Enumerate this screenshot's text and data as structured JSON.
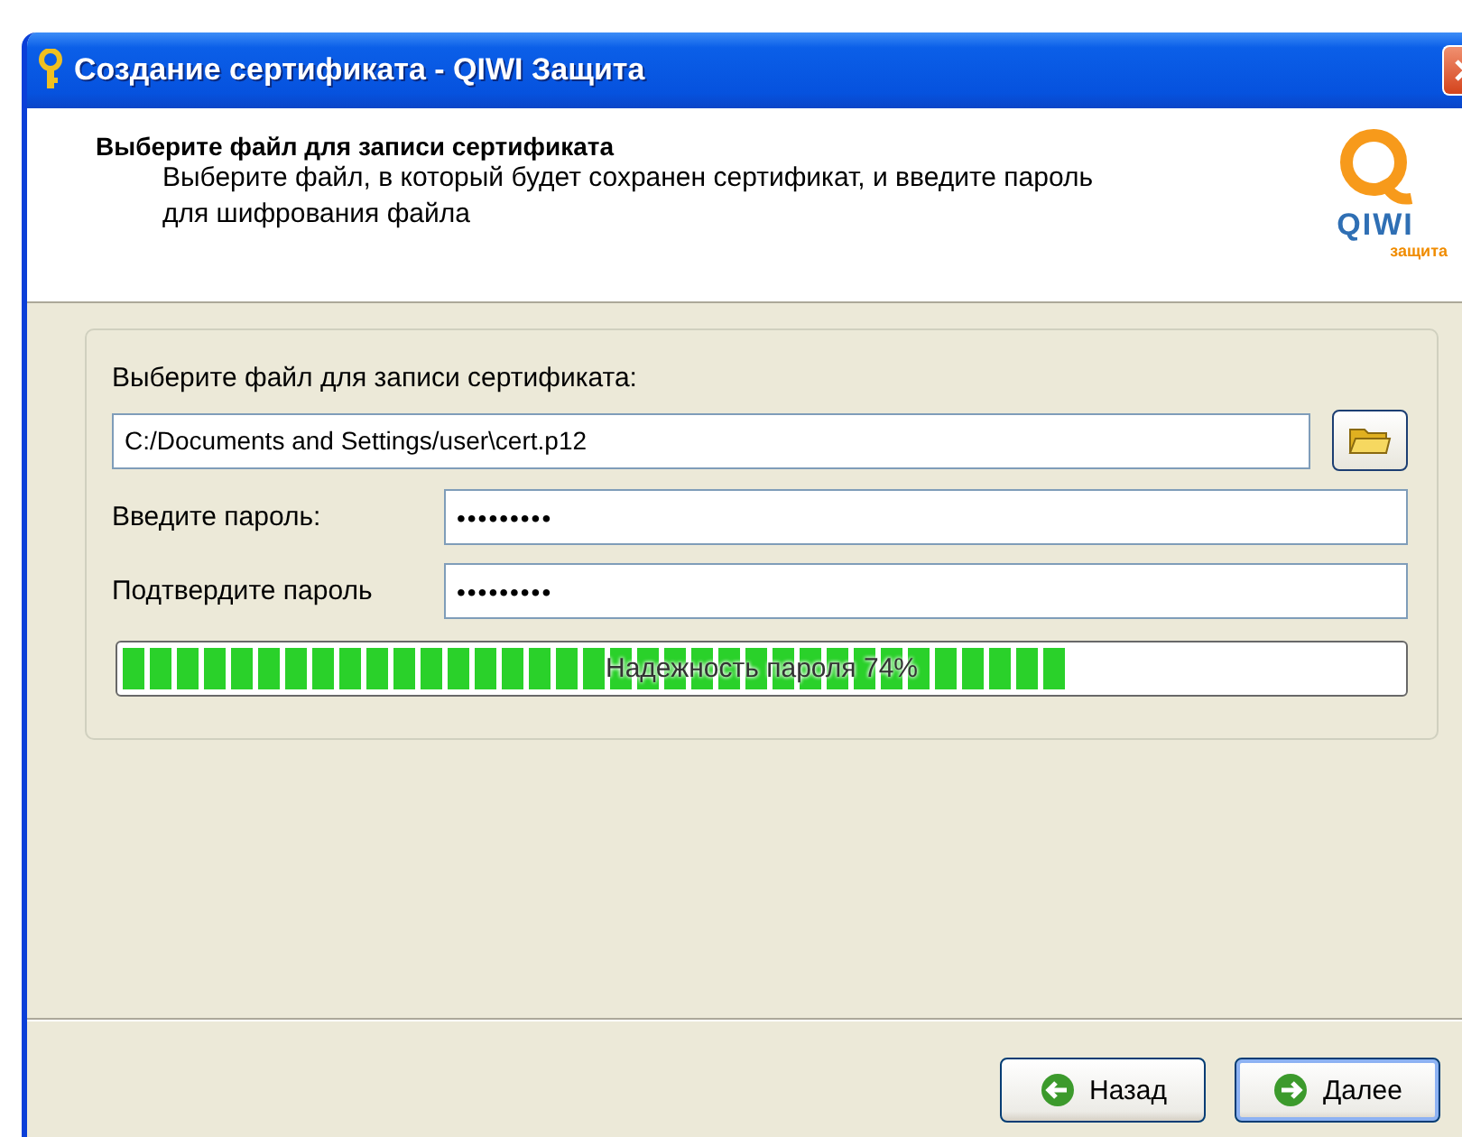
{
  "window": {
    "title": "Создание сертификата - QIWI Защита"
  },
  "header": {
    "title": "Выберите файл для записи сертификата",
    "description": "Выберите файл, в который будет сохранен сертификат, и введите пароль для шифрования файла",
    "logo": {
      "name": "QIWI",
      "tagline": "защита"
    }
  },
  "form": {
    "file_label": "Выберите файл для записи сертификата:",
    "file_path": "C:/Documents and Settings/user\\cert.p12",
    "fields": [
      {
        "label": "Введите пароль:",
        "value": "•••••••••"
      },
      {
        "label": "Подтвердите пароль",
        "value": "•••••••••"
      }
    ],
    "strength": {
      "level": 0.74,
      "text": "Надежность пароля 74%"
    }
  },
  "buttons": [
    {
      "label": "Назад",
      "kind": "back",
      "default": false
    },
    {
      "label": "Далее",
      "kind": "next",
      "default": true
    }
  ]
}
